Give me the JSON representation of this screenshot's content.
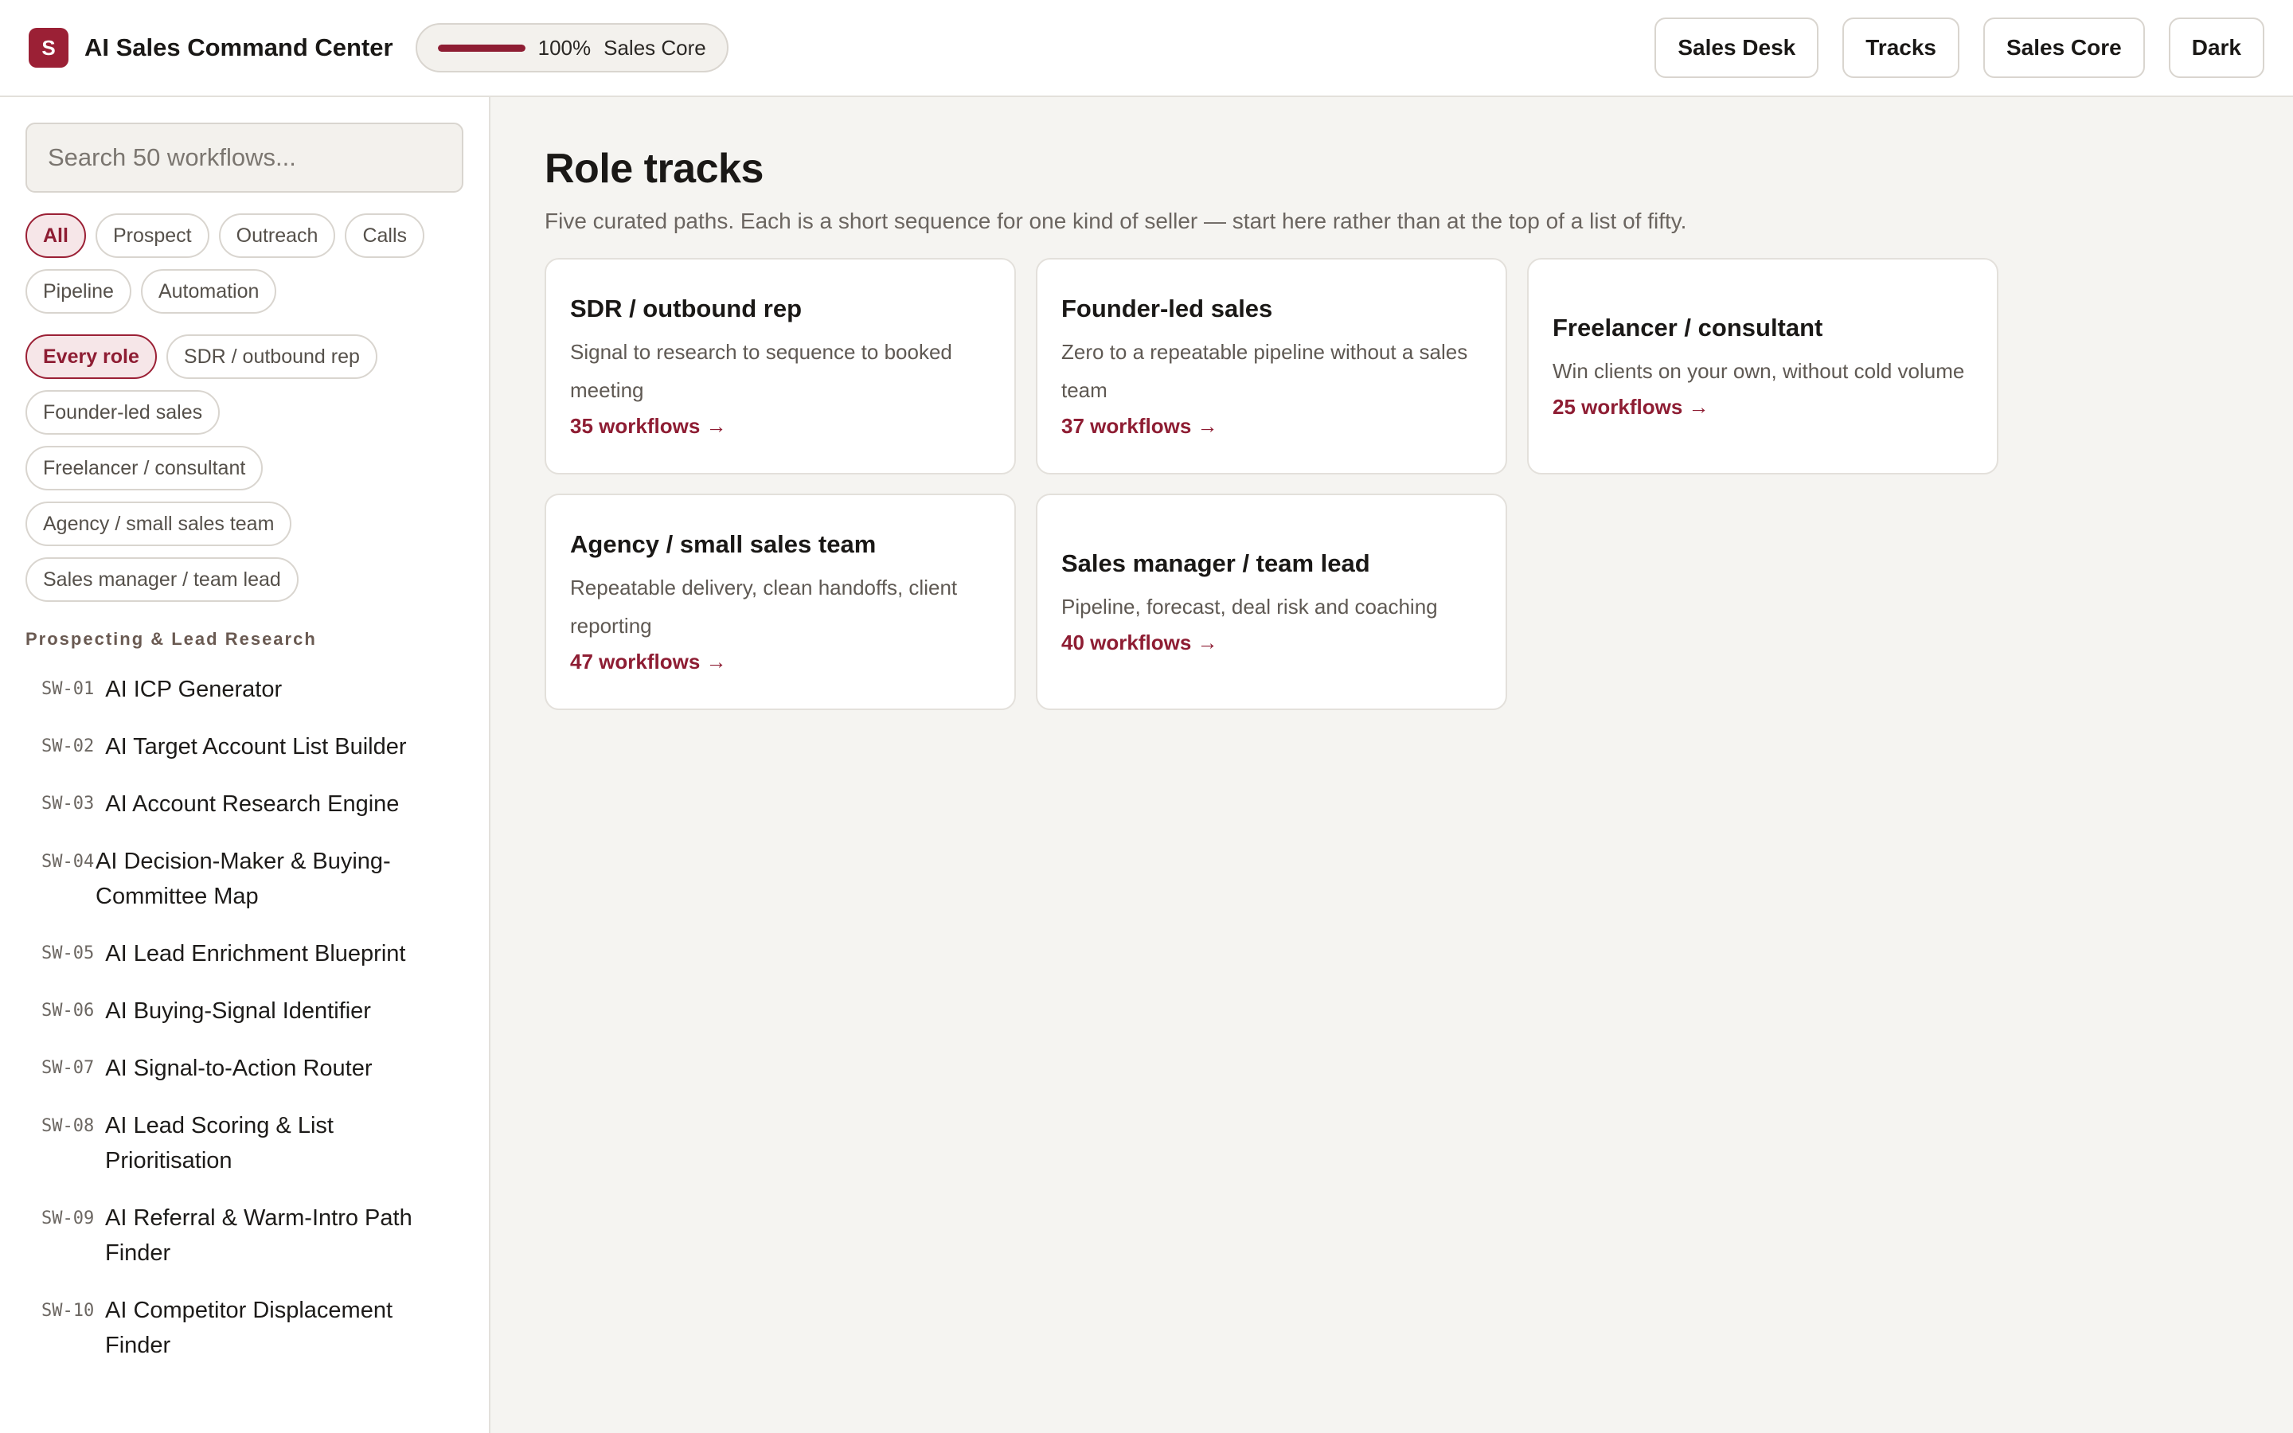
{
  "app": {
    "logo_letter": "S",
    "title": "AI Sales Command Center"
  },
  "progress": {
    "value_percent": 100,
    "text": "100%",
    "label": "Sales Core"
  },
  "header_buttons": {
    "sales_desk": "Sales Desk",
    "tracks": "Tracks",
    "sales_core": "Sales Core",
    "dark": "Dark"
  },
  "sidebar": {
    "search_placeholder": "Search 50 workflows...",
    "category_chips": [
      "All",
      "Prospect",
      "Outreach",
      "Calls",
      "Pipeline",
      "Automation"
    ],
    "role_chips": [
      "Every role",
      "SDR / outbound rep",
      "Founder-led sales",
      "Freelancer / consultant",
      "Agency / small sales team",
      "Sales manager / team lead"
    ],
    "section_title": "Prospecting & Lead Research",
    "workflows": [
      {
        "code": "SW-01",
        "name": "AI ICP Generator"
      },
      {
        "code": "SW-02",
        "name": "AI Target Account List Builder"
      },
      {
        "code": "SW-03",
        "name": "AI Account Research Engine"
      },
      {
        "code": "SW-04",
        "name": "AI Decision-Maker & Buying-Committee Map"
      },
      {
        "code": "SW-05",
        "name": "AI Lead Enrichment Blueprint"
      },
      {
        "code": "SW-06",
        "name": "AI Buying-Signal Identifier"
      },
      {
        "code": "SW-07",
        "name": "AI Signal-to-Action Router"
      },
      {
        "code": "SW-08",
        "name": "AI Lead Scoring & List Prioritisation"
      },
      {
        "code": "SW-09",
        "name": "AI Referral & Warm-Intro Path Finder"
      },
      {
        "code": "SW-10",
        "name": "AI Competitor Displacement Finder"
      }
    ]
  },
  "main": {
    "title": "Role tracks",
    "subtitle": "Five curated paths. Each is a short sequence for one kind of seller — start here rather than at the top of a list of fifty.",
    "cards": [
      {
        "title": "SDR / outbound rep",
        "desc": "Signal to research to sequence to booked meeting",
        "link": "35 workflows →"
      },
      {
        "title": "Founder-led sales",
        "desc": "Zero to a repeatable pipeline without a sales team",
        "link": "37 workflows →"
      },
      {
        "title": "Freelancer / consultant",
        "desc": "Win clients on your own, without cold volume",
        "link": "25 workflows →"
      },
      {
        "title": "Agency / small sales team",
        "desc": "Repeatable delivery, clean handoffs, client reporting",
        "link": "47 workflows →"
      },
      {
        "title": "Sales manager / team lead",
        "desc": "Pipeline, forecast, deal risk and coaching",
        "link": "40 workflows →"
      }
    ]
  },
  "colors": {
    "accent": "#9b2035",
    "accent_dark": "#8e1d33",
    "background": "#f5f4f1",
    "surface": "#ffffff",
    "border": "#e3e0db"
  }
}
